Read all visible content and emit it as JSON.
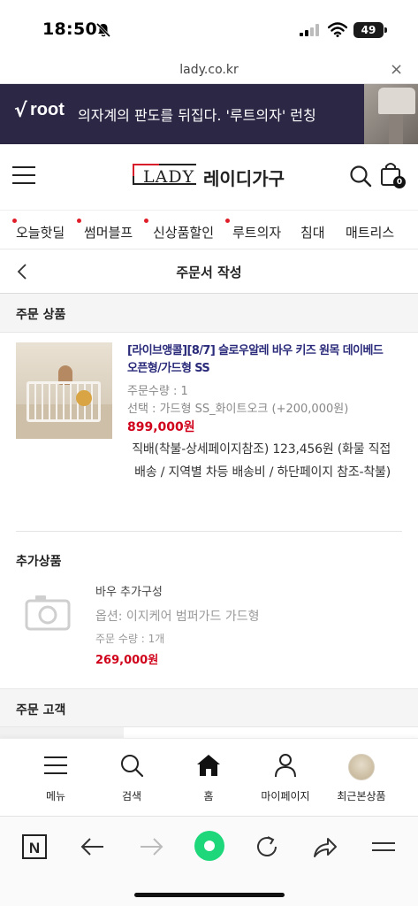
{
  "status_bar": {
    "time": "18:50",
    "battery": "49"
  },
  "browser": {
    "url": "lady.co.kr",
    "close": "×"
  },
  "banner": {
    "brand": "root",
    "copy": "의자계의 판도를 뒤집다. '루트의자' 런칭"
  },
  "site_header": {
    "logo_en": "LADY",
    "logo_ko": "레이디가구",
    "cart_count": "0"
  },
  "categories": [
    {
      "label": "오늘핫딜",
      "dot": true
    },
    {
      "label": "썸머블프",
      "dot": true
    },
    {
      "label": "신상품할인",
      "dot": true
    },
    {
      "label": "루트의자",
      "dot": true
    },
    {
      "label": "침대",
      "dot": false
    },
    {
      "label": "매트리스",
      "dot": false
    }
  ],
  "page": {
    "title": "주문서 작성"
  },
  "order_products": {
    "section_label": "주문 상품",
    "items": [
      {
        "name": "[라이브앵콜][8/7] 슬로우알레 바우 키즈 원목 데이베드 오픈형/가드형 SS",
        "quantity": "주문수량 : 1",
        "option": "선택 : 가드형 SS_화이트오크 (+200,000원)",
        "price": "899,000원",
        "shipping": "직배(착불-상세페이지참조) 123,456원 (화물 직접배송 / 지역별 차등 배송비 / 하단페이지 참조-착불)"
      }
    ]
  },
  "addons": {
    "section_label": "추가상품",
    "items": [
      {
        "name": "바우 추가구성",
        "option": "옵션: 이지케어 범퍼가드 가드형",
        "quantity": "주문 수량 : 1개",
        "price": "269,000원"
      }
    ]
  },
  "customer": {
    "section_label": "주문 고객"
  },
  "app_nav": [
    {
      "label": "메뉴",
      "icon": "menu-icon"
    },
    {
      "label": "검색",
      "icon": "search-icon"
    },
    {
      "label": "홈",
      "icon": "home-icon"
    },
    {
      "label": "마이페이지",
      "icon": "user-icon"
    },
    {
      "label": "최근본상품",
      "icon": "recent-product-thumbnail"
    }
  ],
  "browser_toolbar": {
    "n_label": "N"
  },
  "colors": {
    "accent_red": "#d0021b",
    "banner_bg": "#2b2745",
    "browser_green": "#1ed77a"
  }
}
